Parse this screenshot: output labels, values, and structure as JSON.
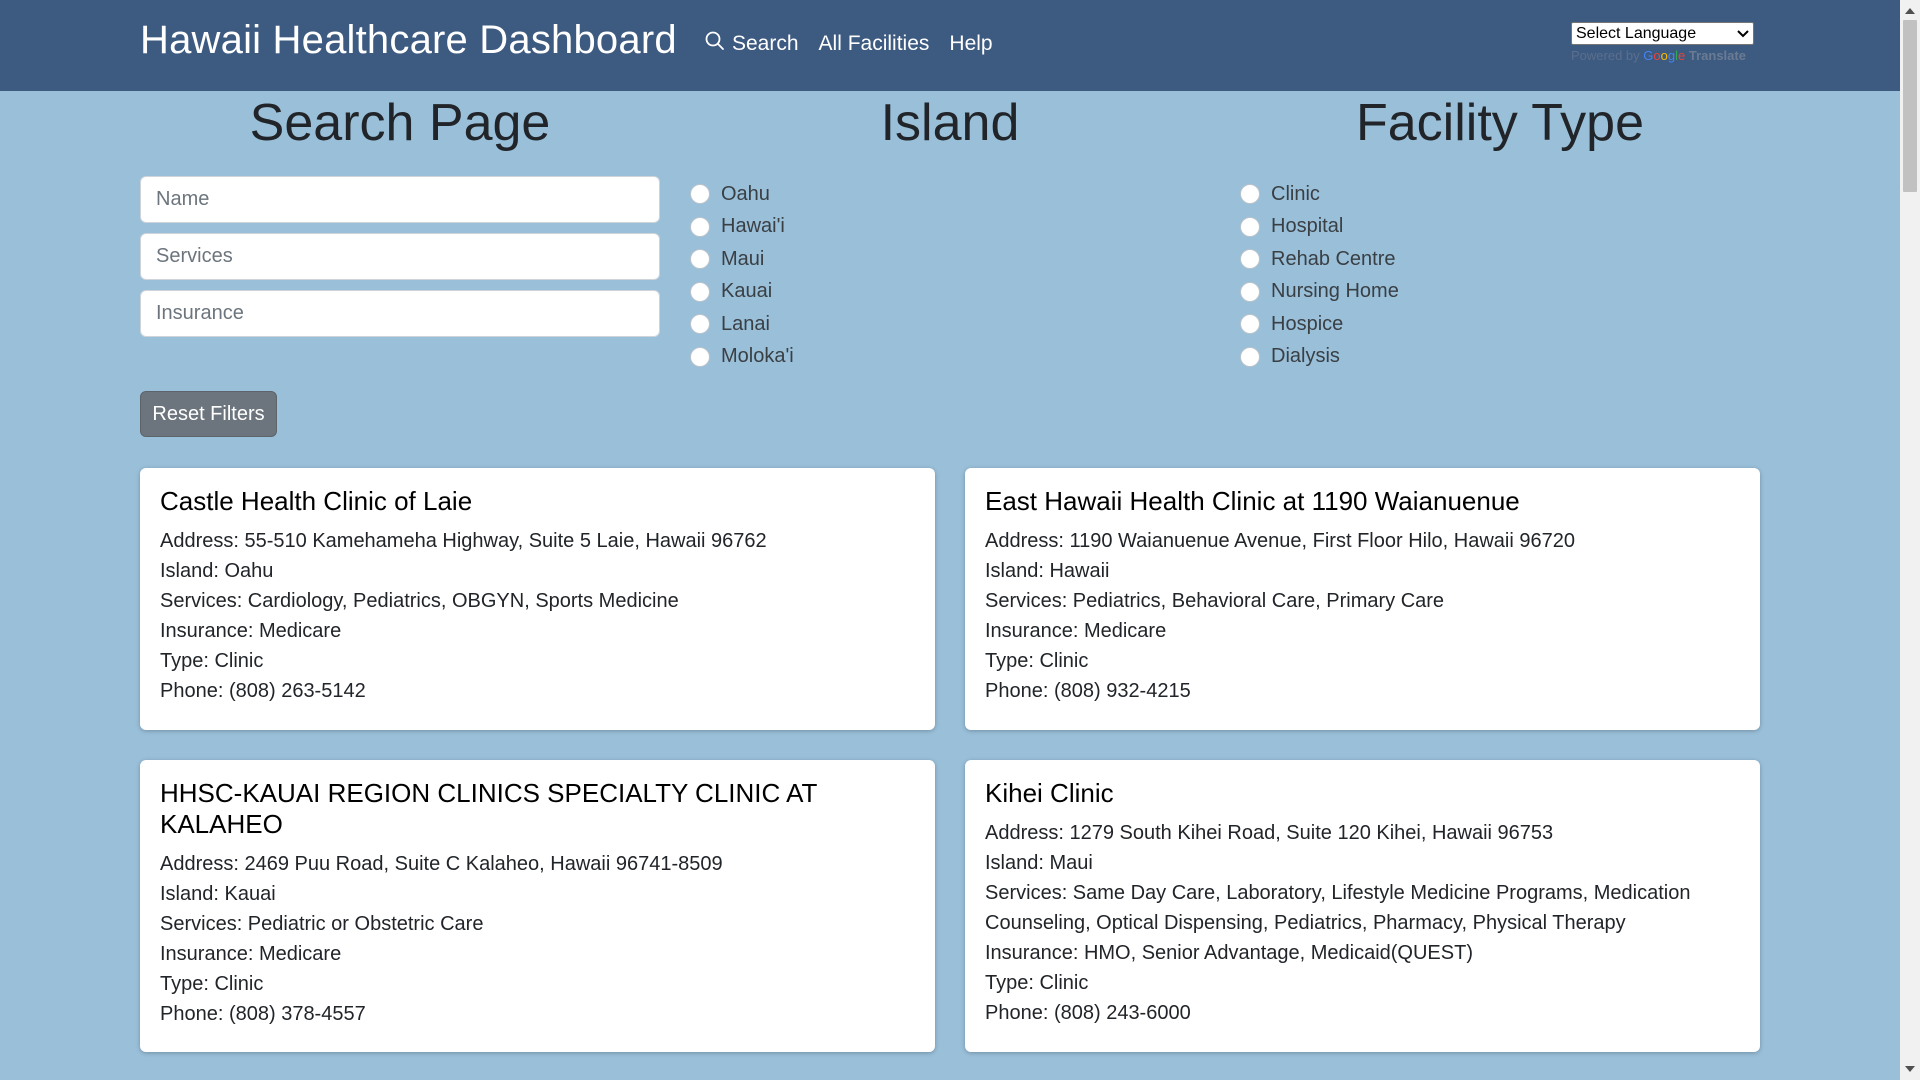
{
  "app": {
    "title": "Hawaii Healthcare Dashboard"
  },
  "nav": {
    "search": "Search",
    "all_facilities": "All Facilities",
    "help": "Help"
  },
  "translate": {
    "select_label": "Select Language",
    "powered_by": "Powered by",
    "google": [
      "G",
      "o",
      "o",
      "g",
      "l",
      "e"
    ],
    "translate": "Translate"
  },
  "sections": {
    "search_title": "Search Page",
    "island_title": "Island",
    "facility_title": "Facility Type"
  },
  "inputs": {
    "name_placeholder": "Name",
    "services_placeholder": "Services",
    "insurance_placeholder": "Insurance"
  },
  "islands": [
    "Oahu",
    "Hawai'i",
    "Maui",
    "Kauai",
    "Lanai",
    "Moloka'i"
  ],
  "facility_types": [
    "Clinic",
    "Hospital",
    "Rehab Centre",
    "Nursing Home",
    "Hospice",
    "Dialysis"
  ],
  "reset_label": "Reset Filters",
  "cards": [
    {
      "name": "Castle Health Clinic of Laie",
      "address": "Address: 55-510 Kamehameha Highway, Suite 5 Laie, Hawaii 96762",
      "island": "Island: Oahu",
      "services": "Services: Cardiology, Pediatrics, OBGYN, Sports Medicine",
      "insurance": "Insurance: Medicare",
      "type": "Type: Clinic",
      "phone": "Phone: (808) 263-5142"
    },
    {
      "name": "East Hawaii Health Clinic at 1190 Waianuenue",
      "address": "Address: 1190 Waianuenue Avenue, First Floor Hilo, Hawaii 96720",
      "island": "Island: Hawaii",
      "services": "Services: Pediatrics, Behavioral Care, Primary Care",
      "insurance": "Insurance: Medicare",
      "type": "Type: Clinic",
      "phone": "Phone: (808) 932-4215"
    },
    {
      "name": "HHSC-KAUAI REGION CLINICS SPECIALTY CLINIC AT KALAHEO",
      "address": "Address: 2469 Puu Road, Suite C Kalaheo, Hawaii 96741-8509",
      "island": "Island: Kauai",
      "services": "Services: Pediatric or Obstetric Care",
      "insurance": "Insurance: Medicare",
      "type": "Type: Clinic",
      "phone": "Phone: (808) 378-4557"
    },
    {
      "name": "Kihei Clinic",
      "address": "Address: 1279 South Kihei Road, Suite 120 Kihei, Hawaii 96753",
      "island": "Island: Maui",
      "services": "Services: Same Day Care, Laboratory, Lifestyle Medicine Programs, Medication Counseling, Optical Dispensing, Pediatrics, Pharmacy, Physical Therapy",
      "insurance": "Insurance: HMO, Senior Advantage, Medicaid(QUEST)",
      "type": "Type: Clinic",
      "phone": "Phone: (808) 243-6000"
    }
  ],
  "colors": {
    "navbar": "#3d5a80",
    "background": "#99bfd9",
    "reset_button": "#6c757d"
  }
}
